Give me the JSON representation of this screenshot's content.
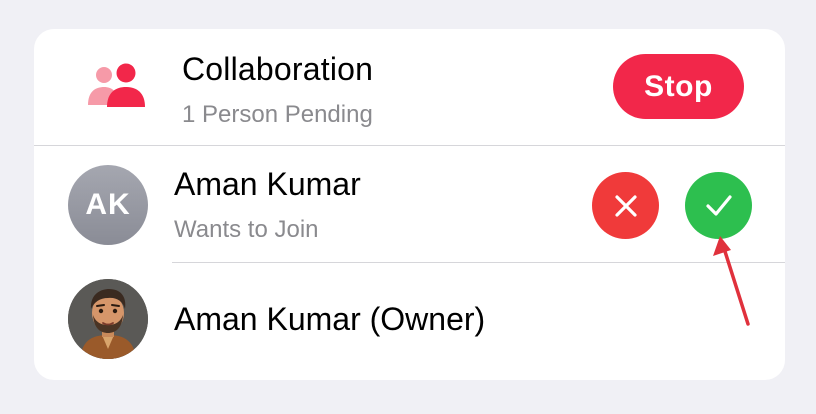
{
  "collaboration": {
    "icon": "people-icon",
    "title": "Collaboration",
    "subtitle": "1 Person Pending",
    "stop_label": "Stop"
  },
  "request": {
    "initials": "AK",
    "name": "Aman Kumar",
    "status": "Wants to Join",
    "decline_icon": "xmark-icon",
    "accept_icon": "checkmark-icon"
  },
  "owner": {
    "avatar_icon": "memoji-avatar",
    "name": "Aman Kumar (Owner)"
  },
  "colors": {
    "accent_red": "#f2274a",
    "decline_red": "#f03a3a",
    "accept_green": "#2dbf4f",
    "annotation_arrow": "#e0313c"
  }
}
